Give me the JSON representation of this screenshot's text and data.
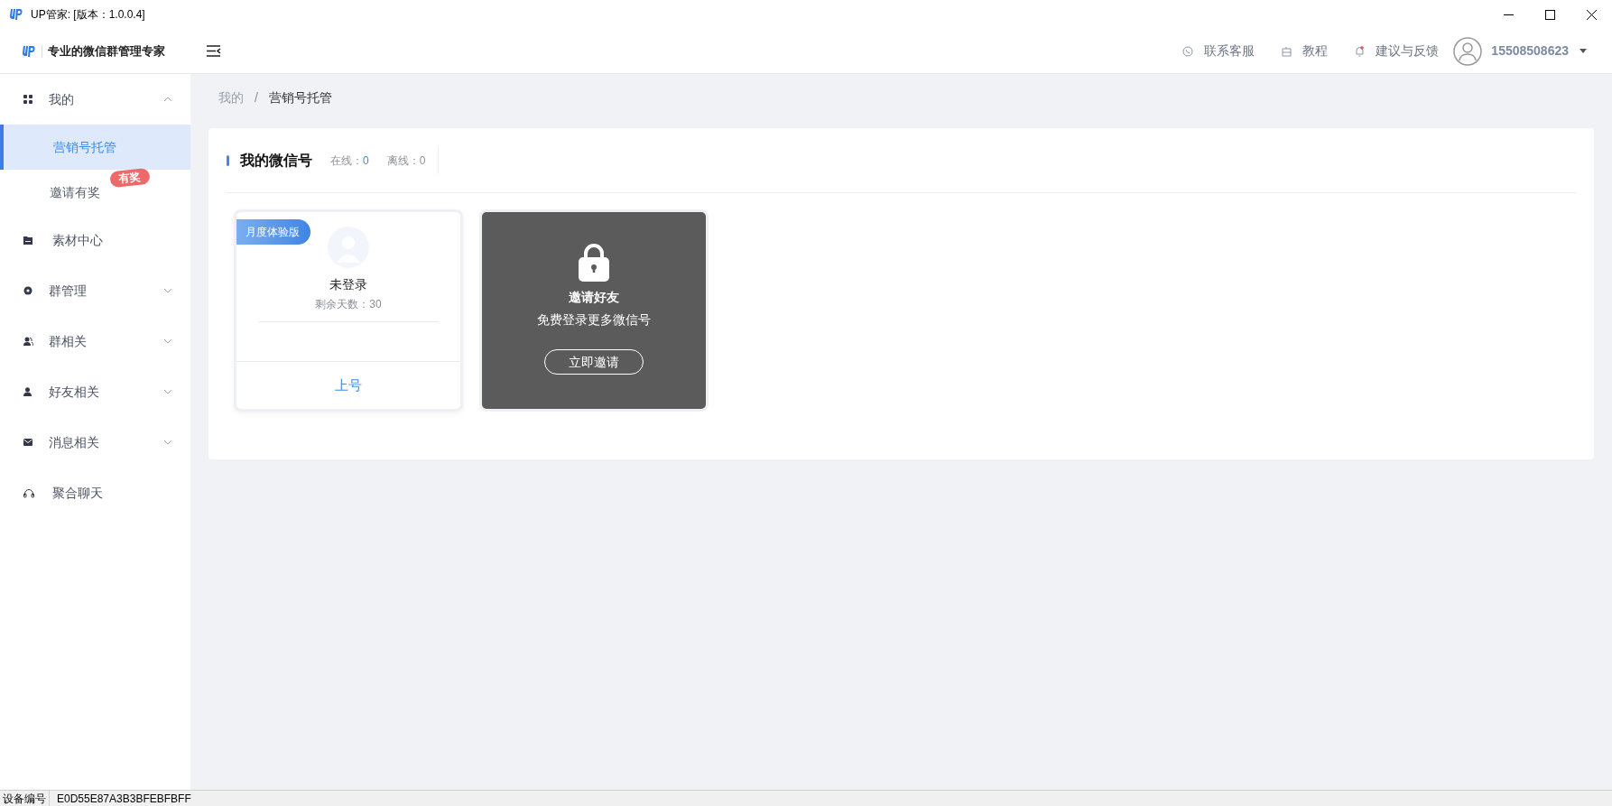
{
  "window": {
    "title": "UP管家: [版本：1.0.0.4]"
  },
  "header": {
    "brand": "专业的微信群管理专家",
    "links": [
      "联系客服",
      "教程",
      "建议与反馈"
    ],
    "user": "15508508623"
  },
  "sidebar": {
    "items": [
      {
        "label": "我的",
        "kind": "group",
        "expanded": true,
        "children": [
          {
            "label": "营销号托管",
            "selected": true
          },
          {
            "label": "邀请有奖",
            "selected": false,
            "badge": "有奖"
          }
        ]
      },
      {
        "label": "素材中心",
        "kind": "link"
      },
      {
        "label": "群管理",
        "kind": "group",
        "expanded": false
      },
      {
        "label": "群相关",
        "kind": "group",
        "expanded": false
      },
      {
        "label": "好友相关",
        "kind": "group",
        "expanded": false
      },
      {
        "label": "消息相关",
        "kind": "group",
        "expanded": false
      },
      {
        "label": "聚合聊天",
        "kind": "link"
      }
    ]
  },
  "breadcrumb": {
    "items": [
      "我的",
      "营销号托管"
    ],
    "separator": "/"
  },
  "panel": {
    "title": "我的微信号",
    "stats": [
      {
        "label": "在线：",
        "value": "0",
        "kind": "online"
      },
      {
        "label": "离线：",
        "value": "0",
        "kind": "offline"
      }
    ]
  },
  "accounts": [
    {
      "kind": "account",
      "tag": "月度体验版",
      "name": "未登录",
      "days": "剩余天数：30",
      "action": "上号"
    },
    {
      "kind": "locked",
      "title": "邀请好友",
      "subtitle": "免费登录更多微信号",
      "button": "立即邀请"
    }
  ],
  "status_bar": {
    "label": "设备编号",
    "value": "E0D55E87A3B3BFEBFBFF"
  }
}
